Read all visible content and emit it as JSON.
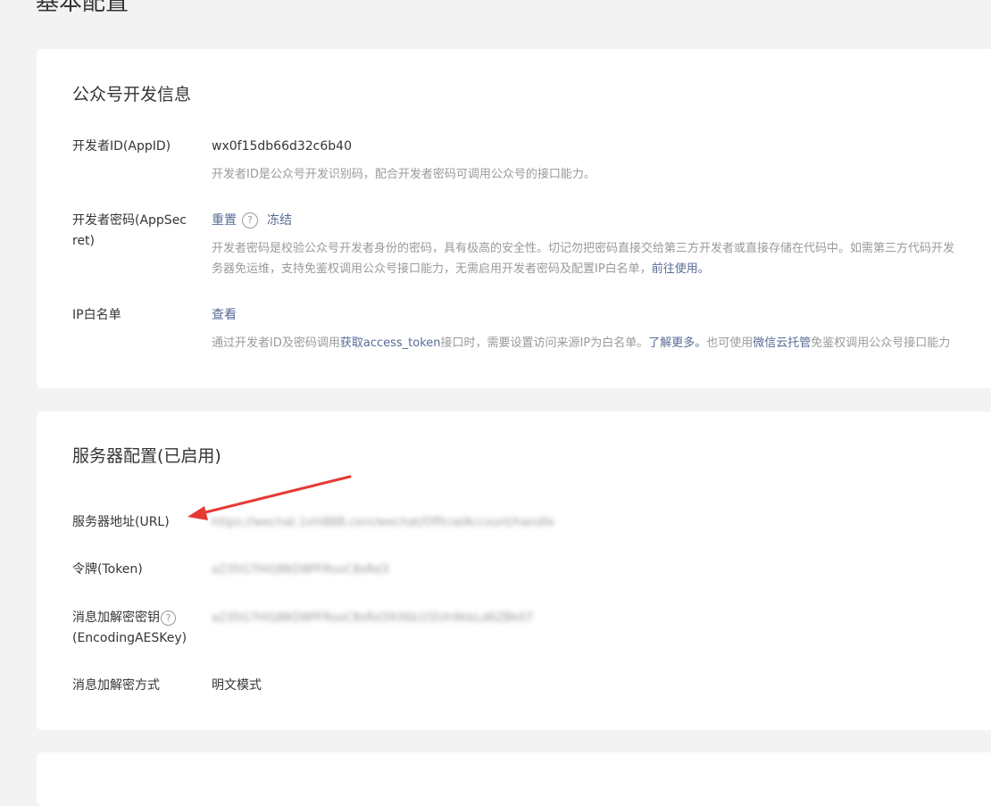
{
  "page_title": "基本配置",
  "dev_info": {
    "title": "公众号开发信息",
    "appid": {
      "label": "开发者ID(AppID)",
      "value": "wx0f15db66d32c6b40",
      "desc": "开发者ID是公众号开发识别码，配合开发者密码可调用公众号的接口能力。"
    },
    "appsecret": {
      "label": "开发者密码(AppSecret)",
      "reset_label": "重置",
      "freeze_label": "冻结",
      "desc_line1": "开发者密码是校验公众号开发者身份的密码，具有极高的安全性。切记勿把密码直接交给第三方开发者或直接存储在代码中。如需第三方代码开发",
      "desc_line2_prefix": "务器免运维，支持免鉴权调用公众号接口能力，无需启用开发者密码及配置IP白名单，",
      "desc_line2_link": "前往使用。"
    },
    "ip_whitelist": {
      "label": "IP白名单",
      "view_label": "查看",
      "desc_part1": "通过开发者ID及密码调用",
      "desc_link1": "获取access_token",
      "desc_part2": "接口时，需要设置访问来源IP为白名单。",
      "desc_link2": "了解更多。",
      "desc_part3": "也可使用",
      "desc_link3": "微信云托管",
      "desc_part4": "免鉴权调用公众号接口能力"
    }
  },
  "server_config": {
    "title": "服务器配置(已启用)",
    "url": {
      "label": "服务器地址(URL)",
      "value": "https://wechat.1shl888.com/wechat/OfficialAccount/handle"
    },
    "token": {
      "label": "令牌(Token)",
      "value": "a235G7HiQ8KD8PFRsoC8sRd3"
    },
    "aeskey": {
      "label_line1": "消息加解密密钥",
      "label_line2": "(EncodingAESKey)",
      "value": "a235G7HiQ8KD8PFRsoC8sRd3936b1f2Uh9kbLd6ZBk07"
    },
    "mode": {
      "label": "消息加解密方式",
      "value": "明文模式"
    }
  },
  "colors": {
    "link": "#576b95",
    "arrow": "#e53935",
    "muted": "#9a9a9a"
  }
}
